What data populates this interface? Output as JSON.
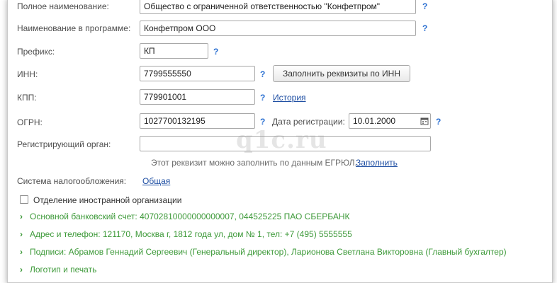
{
  "fields": {
    "full_name_label": "Полное наименование:",
    "full_name_value": "Общество с ограниченной ответственностью \"Конфетпром\"",
    "prog_name_label": "Наименование в программе:",
    "prog_name_value": "Конфетпром ООО",
    "prefix_label": "Префикс:",
    "prefix_value": "КП",
    "inn_label": "ИНН:",
    "inn_value": "7799555550",
    "inn_fill_button": "Заполнить реквизиты по ИНН",
    "kpp_label": "КПП:",
    "kpp_value": "779901001",
    "kpp_history_link": "История",
    "ogrn_label": "ОГРН:",
    "ogrn_value": "1027700132195",
    "reg_date_label": "Дата регистрации:",
    "reg_date_value": "10.01.2000",
    "reg_org_label": "Регистрирующий орган:",
    "reg_org_value": "",
    "egrul_hint": "Этот реквизит можно заполнить по данным ЕГРЮЛ.",
    "egrul_fill_link": "Заполнить",
    "tax_label": "Система налогообложения:",
    "tax_link": "Общая",
    "foreign_branch_label": "Отделение иностранной организации"
  },
  "help_mark": "?",
  "watermark": "q1c.ru",
  "groups": [
    "Основной банковский счет: 40702810000000000007, 044525225 ПАО СБЕРБАНК",
    "Адрес и телефон: 121170, Москва г, 1812 года ул, дом № 1, тел: +7 (495) 5555555",
    "Подписи: Абрамов Геннадий Сергеевич (Генеральный директор), Ларионова Светлана Викторовна (Главный бухгалтер)",
    "Логотип и печать"
  ],
  "colors": {
    "group_green": "#3e9a3a",
    "link_blue": "#1f4fa3",
    "help_blue": "#2a6fd1"
  }
}
